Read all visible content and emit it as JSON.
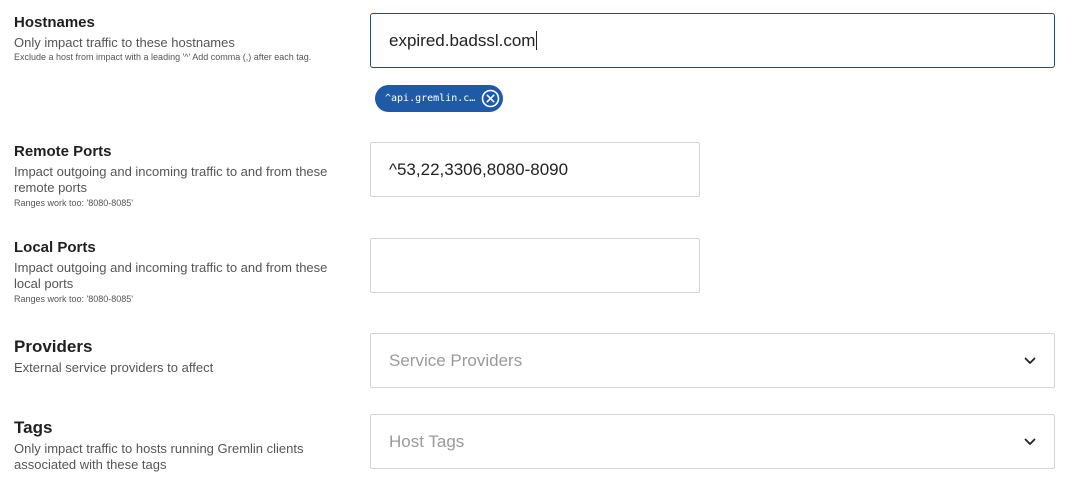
{
  "hostnames": {
    "title": "Hostnames",
    "description": "Only impact traffic to these hostnames",
    "hint": "Exclude a host from impact with a leading '^' Add comma (,) after each tag.",
    "input_value": "expired.badssl.com",
    "tags": [
      "^api.gremlin.c…"
    ]
  },
  "remote_ports": {
    "title": "Remote Ports",
    "description": "Impact outgoing and incoming traffic to and from these remote ports",
    "hint": "Ranges work too: '8080-8085'",
    "input_value": "^53,22,3306,8080-8090"
  },
  "local_ports": {
    "title": "Local Ports",
    "description": "Impact outgoing and incoming traffic to and from these local ports",
    "hint": "Ranges work too: '8080-8085'",
    "input_value": ""
  },
  "providers": {
    "title": "Providers",
    "description": "External service providers to affect",
    "placeholder": "Service Providers"
  },
  "tags": {
    "title": "Tags",
    "description": "Only impact traffic to hosts running Gremlin clients associated with these tags",
    "placeholder": "Host Tags"
  },
  "colors": {
    "focus_border": "#1b4f8a",
    "chip_background": "#1e5aa8",
    "border": "#d4d4d4",
    "placeholder": "#9a9a9a"
  },
  "icons": {
    "dropdown": "chevron-down-icon",
    "chip_remove": "close-circle-icon"
  }
}
